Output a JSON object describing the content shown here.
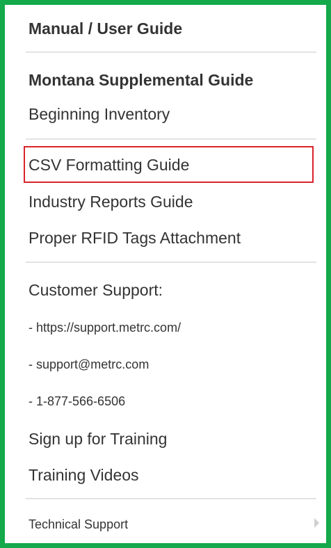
{
  "menu": {
    "header": "Manual / User Guide",
    "group1": [
      "Montana Supplemental Guide",
      "Beginning Inventory"
    ],
    "group2": [
      "CSV Formatting Guide",
      "Industry Reports Guide",
      "Proper RFID Tags Attachment"
    ],
    "support": {
      "title": "Customer Support:",
      "url": "- https://support.metrc.com/",
      "email": "- support@metrc.com",
      "phone": "- 1-877-566-6506"
    },
    "training": [
      "Sign up for Training",
      "Training Videos"
    ],
    "technical_support": "Technical Support"
  },
  "colors": {
    "frame": "#14a94a",
    "highlight": "#d9232a",
    "divider": "#e3e3e3",
    "text": "#333333"
  },
  "icons": {
    "submenu": "chevron-right-icon"
  }
}
